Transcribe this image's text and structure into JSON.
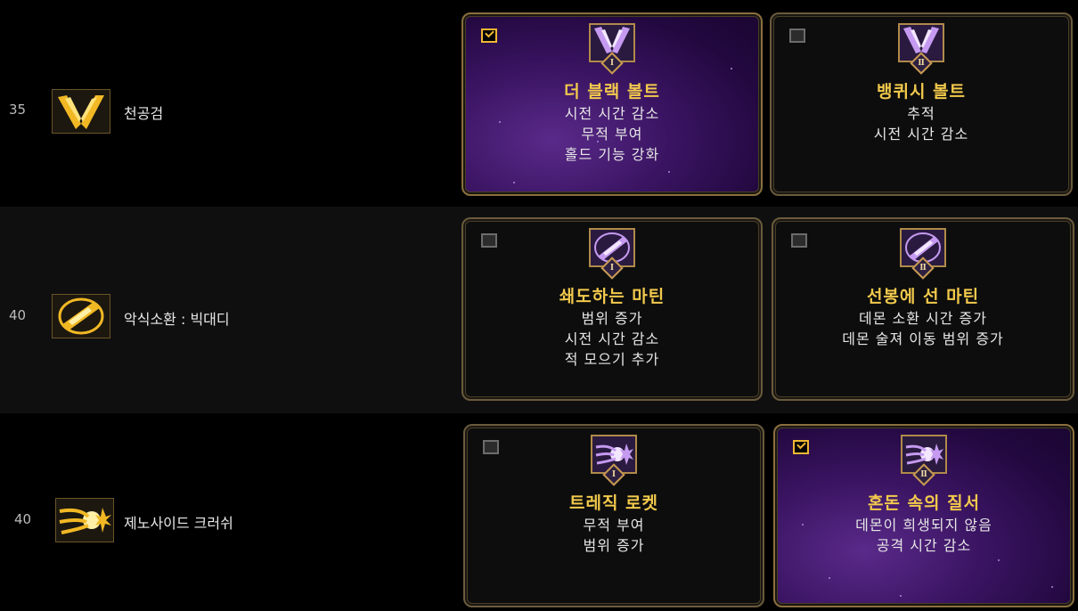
{
  "skills": [
    {
      "level": "35",
      "name": "천공검",
      "icon": "sky-sword-icon",
      "runes": [
        {
          "selected": true,
          "numeral": "Ⅰ",
          "title": "더 블랙 볼트",
          "effects": [
            "시전 시간 감소",
            "무적 부여",
            "홀드 기능 강화"
          ]
        },
        {
          "selected": false,
          "numeral": "Ⅱ",
          "title": "뱅퀴시 볼트",
          "effects": [
            "추적",
            "시전 시간 감소"
          ]
        }
      ]
    },
    {
      "level": "40",
      "name": "악식소환 : 빅대디",
      "icon": "big-daddy-summon-icon",
      "runes": [
        {
          "selected": false,
          "numeral": "Ⅰ",
          "title": "쇄도하는 마틴",
          "effects": [
            "범위 증가",
            "시전 시간 감소",
            "적 모으기 추가"
          ]
        },
        {
          "selected": false,
          "numeral": "Ⅱ",
          "title": "선봉에 선 마틴",
          "effects": [
            "데몬 소환 시간 증가",
            "데몬 술져 이동 범위 증가"
          ]
        }
      ]
    },
    {
      "level": "40",
      "name": "제노사이드 크러쉬",
      "icon": "genocide-crush-icon",
      "runes": [
        {
          "selected": false,
          "numeral": "Ⅰ",
          "title": "트레직 로켓",
          "effects": [
            "무적 부여",
            "범위 증가"
          ]
        },
        {
          "selected": true,
          "numeral": "Ⅱ",
          "title": "혼돈 속의 질서",
          "effects": [
            "데몬이 희생되지 않음",
            "공격 시간 감소"
          ]
        }
      ]
    }
  ],
  "colors": {
    "gold": "#f2c94c",
    "selected_purple": "#3a1462",
    "border": "#6a5a3c"
  }
}
